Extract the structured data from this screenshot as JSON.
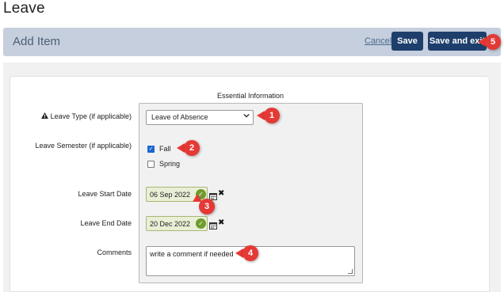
{
  "page": {
    "title": "Leave"
  },
  "header": {
    "title": "Add Item",
    "cancel_label": "Cancel",
    "save_label": "Save",
    "save_exit_label": "Save and exit"
  },
  "form": {
    "section_title": "Essential Information",
    "leave_type": {
      "label": "Leave Type (if applicable)",
      "value": "Leave of Absence"
    },
    "leave_semester": {
      "label": "Leave Semester (if applicable)",
      "options": [
        {
          "label": "Fall",
          "checked": true
        },
        {
          "label": "Spring",
          "checked": false
        }
      ]
    },
    "start_date": {
      "label": "Leave Start Date",
      "value": "06 Sep 2022"
    },
    "end_date": {
      "label": "Leave End Date",
      "value": "20 Dec 2022"
    },
    "comments": {
      "label": "Comments",
      "value": "write a comment if needed"
    }
  },
  "callouts": [
    "1",
    "2",
    "3",
    "4",
    "5"
  ],
  "colors": {
    "header_bar": "#c5cfdd",
    "button": "#1e3f6b",
    "callout": "#e53935",
    "date_bg": "#e9efd6",
    "check_ok": "#6f9b2c"
  },
  "icons": [
    "warning-icon",
    "chevron-down-icon",
    "checkmark-icon",
    "calendar-icon",
    "clear-icon"
  ]
}
